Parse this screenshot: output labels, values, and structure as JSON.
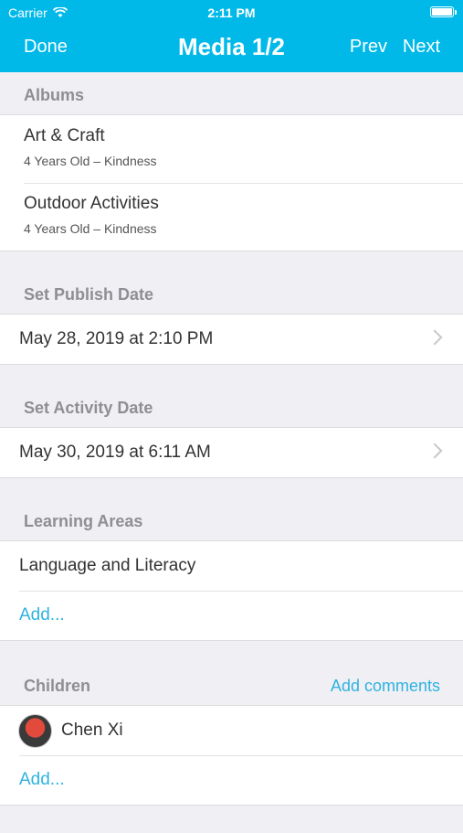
{
  "status_bar": {
    "carrier": "Carrier",
    "time": "2:11 PM"
  },
  "nav": {
    "done": "Done",
    "title": "Media 1/2",
    "prev": "Prev",
    "next": "Next"
  },
  "albums": {
    "header": "Albums",
    "items": [
      {
        "title": "Art & Craft",
        "subtitle": "4 Years Old – Kindness"
      },
      {
        "title": "Outdoor Activities",
        "subtitle": "4 Years Old – Kindness"
      }
    ]
  },
  "publish_date": {
    "header": "Set Publish Date",
    "value": "May 28, 2019 at 2:10 PM"
  },
  "activity_date": {
    "header": "Set Activity Date",
    "value": "May 30, 2019 at 6:11 AM"
  },
  "learning_areas": {
    "header": "Learning Areas",
    "items": [
      "Language and Literacy"
    ],
    "add_label": "Add..."
  },
  "children": {
    "header": "Children",
    "action": "Add comments",
    "items": [
      {
        "name": "Chen Xi"
      }
    ],
    "add_label": "Add..."
  },
  "colors": {
    "accent": "#00b9e9",
    "link": "#2fb3e0",
    "background": "#efeff4"
  }
}
